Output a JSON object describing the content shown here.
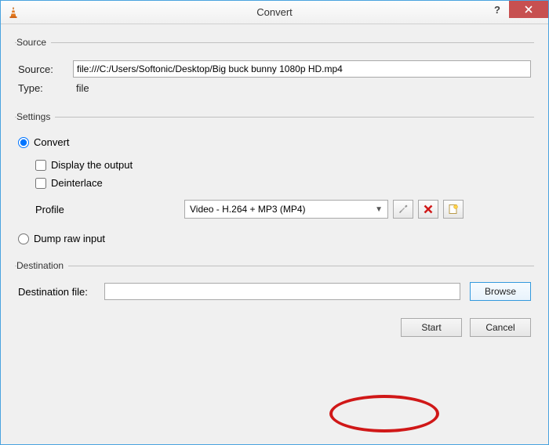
{
  "window": {
    "title": "Convert"
  },
  "source_group": {
    "legend": "Source",
    "source_label": "Source:",
    "source_value": "file:///C:/Users/Softonic/Desktop/Big buck bunny 1080p HD.mp4",
    "type_label": "Type:",
    "type_value": "file"
  },
  "settings_group": {
    "legend": "Settings",
    "convert_label": "Convert",
    "display_output_label": "Display the output",
    "deinterlace_label": "Deinterlace",
    "profile_label": "Profile",
    "profile_selected": "Video - H.264 + MP3 (MP4)",
    "dump_raw_label": "Dump raw input"
  },
  "destination_group": {
    "legend": "Destination",
    "dest_label": "Destination file:",
    "dest_value": "",
    "browse_label": "Browse"
  },
  "buttons": {
    "start": "Start",
    "cancel": "Cancel"
  }
}
